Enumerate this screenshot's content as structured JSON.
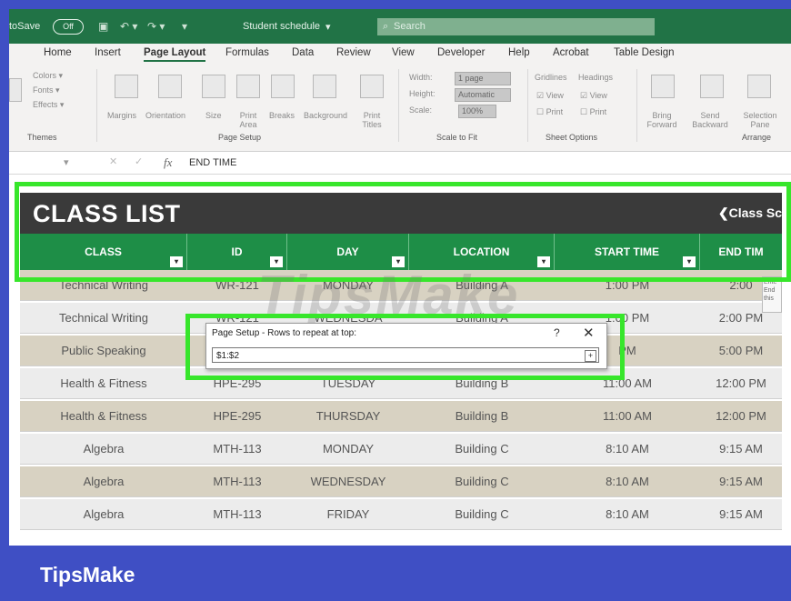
{
  "titlebar": {
    "autosave_label": "toSave",
    "toggle_label": "Off",
    "save_icon": "save-icon",
    "undo_icon": "undo-icon",
    "redo_icon": "redo-icon",
    "doc_title": "Student schedule",
    "search_placeholder": "Search"
  },
  "ribbon": {
    "tabs": [
      "Home",
      "Insert",
      "Page Layout",
      "Formulas",
      "Data",
      "Review",
      "View",
      "Developer",
      "Help",
      "Acrobat",
      "Table Design"
    ],
    "active_tab": "Page Layout",
    "themes": {
      "colors": "Colors",
      "fonts": "Fonts",
      "effects": "Effects",
      "label": "Themes"
    },
    "page_setup": {
      "items": [
        "Margins",
        "Orientation",
        "Size",
        "Print Area",
        "Breaks",
        "Background",
        "Print Titles"
      ],
      "label": "Page Setup"
    },
    "scale_to_fit": {
      "width": "Width:",
      "width_value": "1 page",
      "height": "Height:",
      "height_value": "Automatic",
      "scale": "Scale:",
      "scale_value": "100%",
      "label": "Scale to Fit"
    },
    "sheet_options": {
      "gridlines": "Gridlines",
      "headings": "Headings",
      "view": "View",
      "print": "Print",
      "label": "Sheet Options"
    },
    "arrange": {
      "items": [
        "Bring Forward",
        "Send Backward",
        "Selection Pane"
      ],
      "label": "Arrange"
    }
  },
  "formula_bar": {
    "fx": "fx",
    "value": "END TIME"
  },
  "banner": {
    "title": "CLASS LIST",
    "link": "Class Sc"
  },
  "table": {
    "headers": [
      "CLASS",
      "ID",
      "DAY",
      "LOCATION",
      "START TIME",
      "END TIM"
    ],
    "rows": [
      [
        "Technical Writing",
        "WR-121",
        "MONDAY",
        "Building A",
        "1:00 PM",
        "2:00"
      ],
      [
        "Technical Writing",
        "WR-121",
        "WEDNESDA",
        "Building A",
        "1:00 PM",
        "2:00 PM"
      ],
      [
        "Public Speaking",
        "",
        "",
        "",
        "PM",
        "5:00 PM"
      ],
      [
        "Health & Fitness",
        "HPE-295",
        "TUESDAY",
        "Building B",
        "11:00 AM",
        "12:00 PM"
      ],
      [
        "Health & Fitness",
        "HPE-295",
        "THURSDAY",
        "Building B",
        "11:00 AM",
        "12:00 PM"
      ],
      [
        "Algebra",
        "MTH-113",
        "MONDAY",
        "Building C",
        "8:10 AM",
        "9:15 AM"
      ],
      [
        "Algebra",
        "MTH-113",
        "WEDNESDAY",
        "Building C",
        "8:10 AM",
        "9:15 AM"
      ],
      [
        "Algebra",
        "MTH-113",
        "FRIDAY",
        "Building C",
        "8:10 AM",
        "9:15 AM"
      ]
    ]
  },
  "note": {
    "text": "Ente End this"
  },
  "dialog": {
    "title": "Page Setup - Rows to repeat at top:",
    "help": "?",
    "close": "✕",
    "input_value": "$1:$2"
  },
  "watermark": "TipsMake",
  "footer": {
    "brand": "TipsMake"
  },
  "colors": {
    "excel_green": "#217346",
    "header_green": "#1e8e47",
    "highlight": "#37e62b",
    "frame": "#3f4fc4",
    "banner": "#3a3a3a",
    "row_tan": "#d8d2c2",
    "row_light": "#ececec"
  }
}
